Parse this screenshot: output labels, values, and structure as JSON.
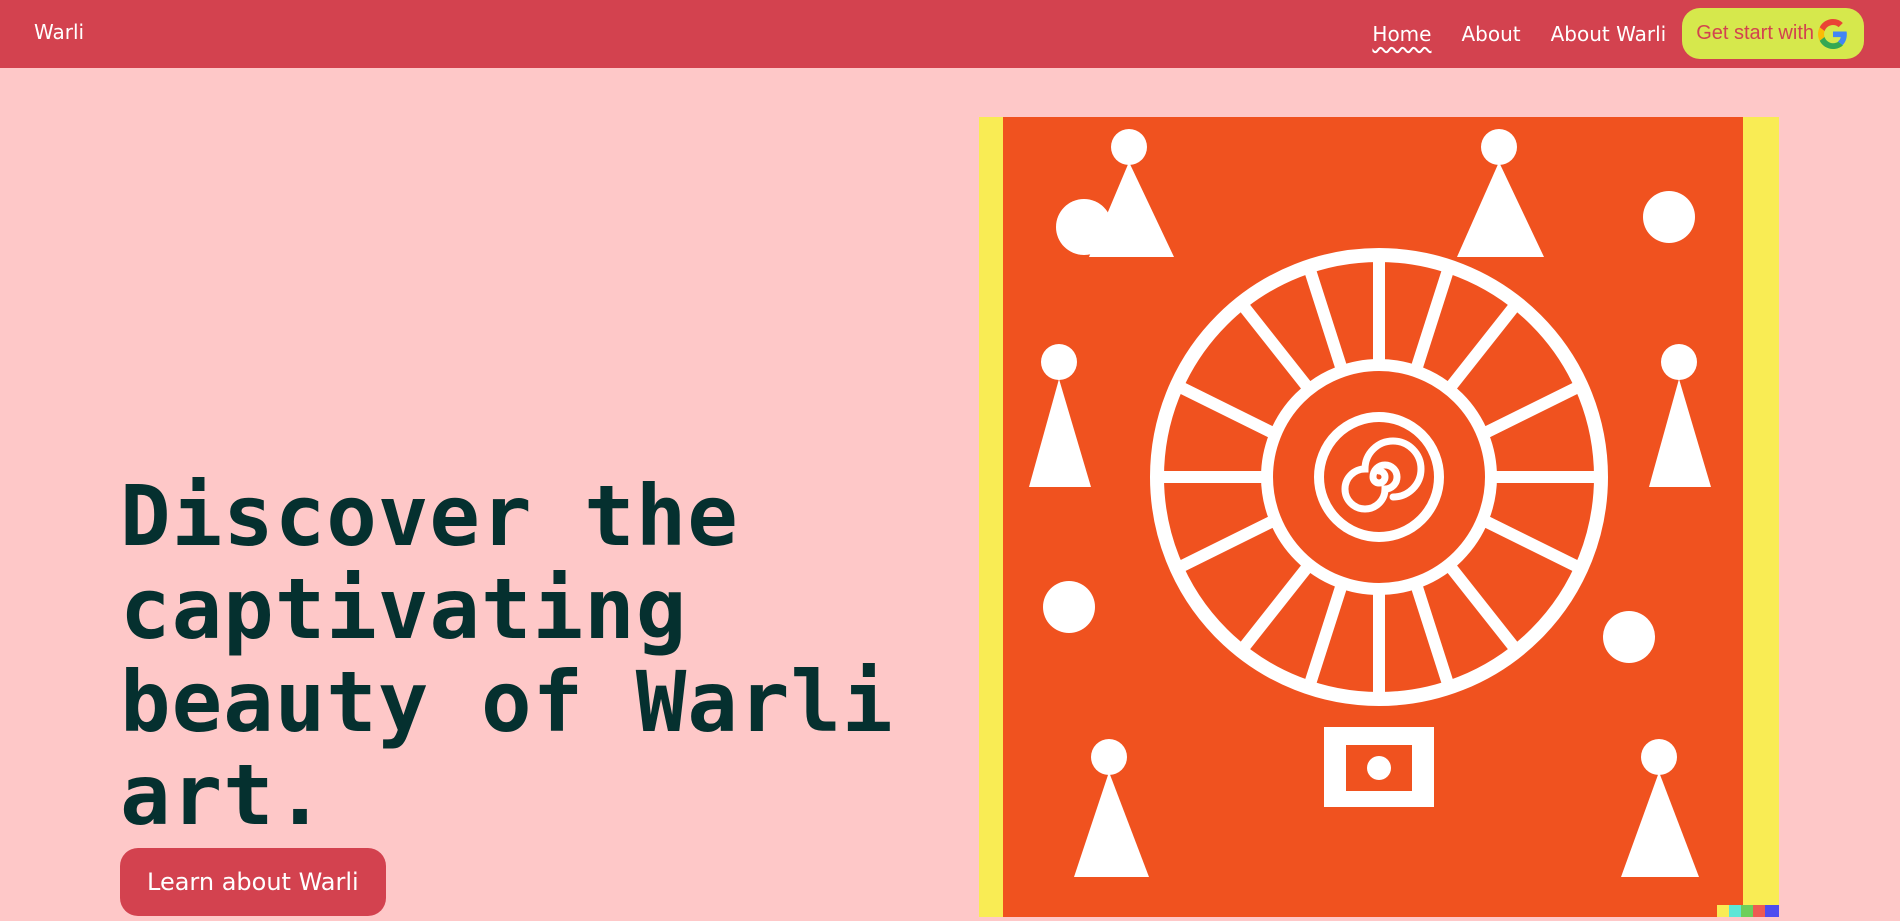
{
  "nav": {
    "brand": "Warli",
    "links": [
      {
        "label": "Home",
        "active": true
      },
      {
        "label": "About",
        "active": false
      },
      {
        "label": "About Warli",
        "active": false
      }
    ],
    "cta_label": "Get start with",
    "cta_icon": "google-icon"
  },
  "hero": {
    "headline": "Discover the captivating beauty of Warli art.",
    "button_label": "Learn about Warli",
    "image_icon": "warli-painting"
  },
  "colors": {
    "navbar": "#d3424f",
    "page_bg": "#fec8c8",
    "cta_bg": "#d6e84c",
    "headline": "#05302f",
    "art_orange": "#f0521f",
    "art_yellow": "#f9ec54"
  }
}
